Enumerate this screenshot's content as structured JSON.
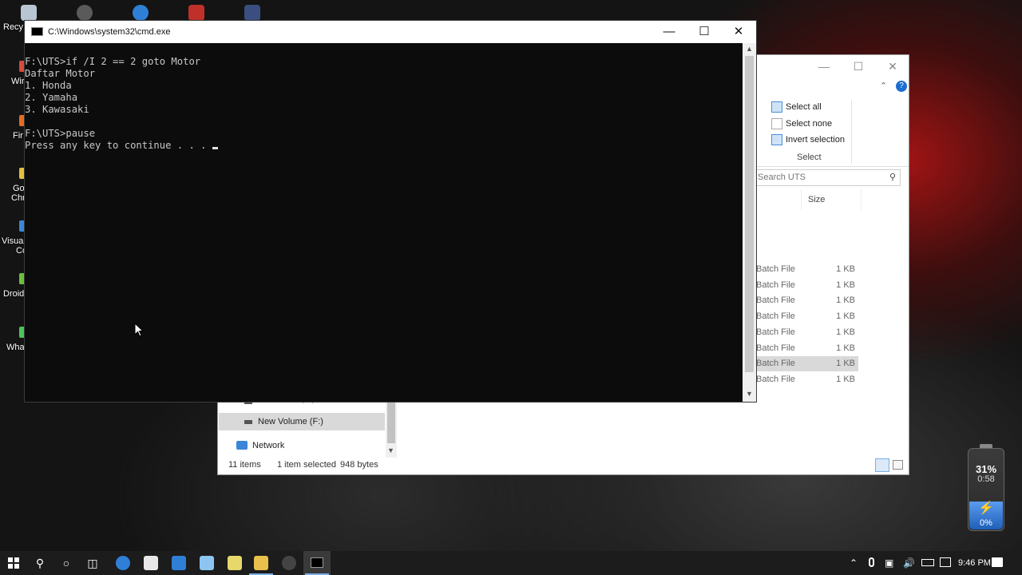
{
  "desktop": {
    "icons": [
      {
        "label": "Recy",
        "color": "#c9d3de"
      },
      {
        "label": "Wir",
        "color": "#d84a3a"
      },
      {
        "label": "Fir",
        "color": "#e66b1f"
      },
      {
        "label": "Go",
        "sub": "Chr",
        "color": "#e0c040"
      },
      {
        "label": "Visual",
        "sub": "Co",
        "color": "#3a86d8"
      },
      {
        "label": "Droid",
        "color": "#6bbf3a"
      },
      {
        "label": "Wha",
        "color": "#4cc35a"
      }
    ]
  },
  "cmd": {
    "title": "C:\\Windows\\system32\\cmd.exe",
    "lines": [
      "F:\\UTS>if /I 2 == 2 goto Motor",
      "Daftar Motor",
      "1. Honda",
      "2. Yamaha",
      "3. Kawasaki",
      "",
      "F:\\UTS>pause",
      "Press any key to continue . . . "
    ]
  },
  "explorer": {
    "ribbon": {
      "select_all": "Select all",
      "select_none": "Select none",
      "invert_selection": "Invert selection",
      "group": "Select"
    },
    "search_placeholder": "Search UTS",
    "column_size": "Size",
    "files": [
      {
        "type": "Batch File",
        "size": "1 KB",
        "selected": false
      },
      {
        "type": "Batch File",
        "size": "1 KB",
        "selected": false
      },
      {
        "type": "Batch File",
        "size": "1 KB",
        "selected": false
      },
      {
        "type": "Batch File",
        "size": "1 KB",
        "selected": false
      },
      {
        "type": "Batch File",
        "size": "1 KB",
        "selected": false
      },
      {
        "type": "Batch File",
        "size": "1 KB",
        "selected": false
      },
      {
        "type": "Batch File",
        "size": "1 KB",
        "selected": true
      },
      {
        "type": "Batch File",
        "size": "1 KB",
        "selected": false
      }
    ],
    "nav": {
      "local_disk": "Local Disk (E:)",
      "new_volume": "New Volume (F:)",
      "network": "Network"
    },
    "status": {
      "items": "11 items",
      "selected": "1 item selected",
      "bytes": "948 bytes"
    }
  },
  "battery_widget": {
    "percent": "31%",
    "time": "0:58",
    "charge": "0%"
  },
  "taskbar": {
    "clock": "9:46 PM",
    "accent": "#2f7fd6"
  }
}
